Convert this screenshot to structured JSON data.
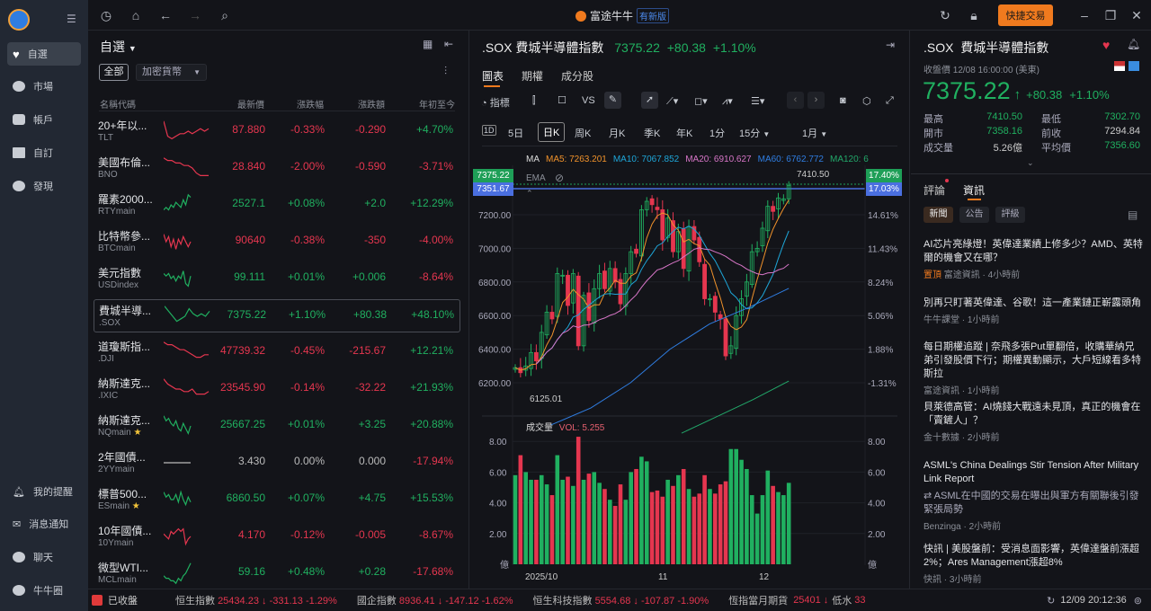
{
  "app": {
    "logo_text": "富途牛牛",
    "badge": "有新版",
    "quick_trade": "快捷交易"
  },
  "sidebar": {
    "items": [
      {
        "label": "自選"
      },
      {
        "label": "市場"
      },
      {
        "label": "帳戶"
      },
      {
        "label": "自訂"
      },
      {
        "label": "發現"
      }
    ],
    "bottom": [
      {
        "label": "我的提醒"
      },
      {
        "label": "消息通知"
      },
      {
        "label": "聊天"
      },
      {
        "label": "牛牛圈"
      }
    ]
  },
  "watchlist": {
    "title": "自選",
    "filter_all": "全部",
    "filter_select": "加密貨幣",
    "headers": [
      "名稱代碼",
      "最新價",
      "漲跌幅",
      "漲跌額",
      "年初至今"
    ],
    "rows": [
      {
        "name": "20+年以...",
        "code": "TLT",
        "price": "87.880",
        "pct": "-0.33%",
        "chg": "-0.290",
        "ytd": "+4.70%",
        "dir": "r",
        "ytd_dir": "g",
        "spark": [
          9,
          3,
          2,
          3,
          4,
          4,
          5,
          4,
          5,
          6,
          5,
          6
        ]
      },
      {
        "name": "美國布倫...",
        "code": "BNO",
        "price": "28.840",
        "pct": "-2.00%",
        "chg": "-0.590",
        "ytd": "-3.71%",
        "dir": "r",
        "ytd_dir": "r",
        "spark": [
          9,
          8,
          8,
          7,
          7,
          6,
          6,
          5,
          3,
          2,
          2,
          2
        ]
      },
      {
        "name": "羅素2000...",
        "code": "RTYmain",
        "price": "2527.1",
        "pct": "+0.08%",
        "chg": "+2.0",
        "ytd": "+12.29%",
        "dir": "g",
        "ytd_dir": "g",
        "spark": [
          3,
          4,
          3,
          5,
          4,
          6,
          5,
          4,
          7,
          5,
          9,
          8
        ]
      },
      {
        "name": "比特幣參...",
        "code": "BTCmain",
        "price": "90640",
        "pct": "-0.38%",
        "chg": "-350",
        "ytd": "-4.00%",
        "dir": "r",
        "ytd_dir": "r",
        "spark": [
          8,
          5,
          7,
          3,
          6,
          2,
          6,
          4,
          7,
          5,
          3,
          5
        ]
      },
      {
        "name": "美元指數",
        "code": "USDindex",
        "price": "99.111",
        "pct": "+0.01%",
        "chg": "+0.006",
        "ytd": "-8.64%",
        "dir": "g",
        "ytd_dir": "r",
        "spark": [
          7,
          6,
          7,
          5,
          6,
          4,
          6,
          5,
          8,
          3,
          2,
          6
        ]
      },
      {
        "name": "費城半導...",
        "code": ".SOX",
        "price": "7375.22",
        "pct": "+1.10%",
        "chg": "+80.38",
        "ytd": "+48.10%",
        "dir": "g",
        "ytd_dir": "g",
        "spark": [
          9,
          7,
          5,
          3,
          4,
          5,
          8,
          6,
          5,
          6,
          5,
          7
        ]
      },
      {
        "name": "道瓊斯指...",
        "code": ".DJI",
        "price": "47739.32",
        "pct": "-0.45%",
        "chg": "-215.67",
        "ytd": "+12.21%",
        "dir": "r",
        "ytd_dir": "g",
        "spark": [
          9,
          8,
          8,
          7,
          6,
          6,
          5,
          4,
          3,
          3,
          4,
          4
        ]
      },
      {
        "name": "納斯達克...",
        "code": ".IXIC",
        "price": "23545.90",
        "pct": "-0.14%",
        "chg": "-32.22",
        "ytd": "+21.93%",
        "dir": "r",
        "ytd_dir": "g",
        "spark": [
          9,
          7,
          6,
          5,
          5,
          4,
          4,
          5,
          3,
          3,
          3,
          4
        ]
      },
      {
        "name": "納斯達克...",
        "code": "NQmain",
        "price": "25667.25",
        "pct": "+0.01%",
        "chg": "+3.25",
        "ytd": "+20.88%",
        "dir": "g",
        "ytd_dir": "g",
        "spark": [
          9,
          7,
          8,
          6,
          5,
          7,
          4,
          3,
          6,
          4,
          2,
          5
        ]
      },
      {
        "name": "2年國債...",
        "code": "2YYmain",
        "price": "3.430",
        "pct": "0.00%",
        "chg": "0.000",
        "ytd": "-17.94%",
        "dir": "n",
        "ytd_dir": "r",
        "spark": [
          5,
          5,
          5,
          5,
          5,
          5,
          5,
          5,
          5,
          5,
          5,
          5
        ]
      },
      {
        "name": "標普500...",
        "code": "ESmain",
        "price": "6860.50",
        "pct": "+0.07%",
        "chg": "+4.75",
        "ytd": "+15.53%",
        "dir": "g",
        "ytd_dir": "g",
        "spark": [
          8,
          6,
          7,
          5,
          5,
          7,
          4,
          8,
          5,
          3,
          6,
          4
        ]
      },
      {
        "name": "10年國債...",
        "code": "10Ymain",
        "price": "4.170",
        "pct": "-0.12%",
        "chg": "-0.005",
        "ytd": "-8.67%",
        "dir": "r",
        "ytd_dir": "r",
        "spark": [
          6,
          5,
          4,
          7,
          6,
          7,
          8,
          7,
          8,
          2,
          4,
          5
        ]
      },
      {
        "name": "微型WTI...",
        "code": "MCLmain",
        "price": "59.16",
        "pct": "+0.48%",
        "chg": "+0.28",
        "ytd": "-17.68%",
        "dir": "g",
        "ytd_dir": "r",
        "spark": [
          4,
          3,
          3,
          2,
          2,
          1,
          3,
          2,
          4,
          5,
          7,
          9
        ]
      }
    ]
  },
  "chart": {
    "code": ".SOX",
    "name": "費城半導體指數",
    "price": "7375.22",
    "chg": "+80.38",
    "pct": "+1.10%",
    "tabs": [
      "圖表",
      "期權",
      "成分股"
    ],
    "toolbar_indicator": "指標",
    "toolbar_vs": "VS",
    "periods": [
      "5日",
      "日K",
      "周K",
      "月K",
      "季K",
      "年K",
      "1分",
      "15分",
      "1月"
    ],
    "ma_label": "MA",
    "ma": [
      {
        "label": "MA5: 7263.201",
        "color": "#f0922b"
      },
      {
        "label": "MA10: 7067.852",
        "color": "#1ea6d8"
      },
      {
        "label": "MA20: 6910.627",
        "color": "#d876c8"
      },
      {
        "label": "MA60: 6762.772",
        "color": "#2f7de1"
      },
      {
        "label": "MA120: 6",
        "color": "#22a86a"
      }
    ],
    "ema_label": "EMA",
    "price_tag": "7375.22",
    "line_tag": "7351.67",
    "pct_tag": "17.40%",
    "line_pct_tag": "17.03%",
    "high_mark": "7410.50",
    "low_mark": "6125.01",
    "y_labels": [
      "7200.00",
      "7000.00",
      "6800.00",
      "6600.00",
      "6400.00",
      "6200.00"
    ],
    "pct_labels": [
      "14.61%",
      "11.43%",
      "8.24%",
      "5.06%",
      "1.88%",
      "-1.31%"
    ],
    "vol_label": "成交量",
    "vol_value": "VOL: 5.255",
    "vol_y_labels": [
      "8.00",
      "6.00",
      "4.00",
      "2.00",
      "億"
    ],
    "x_labels": [
      "2025/10",
      "11",
      "12"
    ]
  },
  "chart_data": {
    "type": "candlestick",
    "ylim": [
      6000,
      7450
    ],
    "closes": [
      6290,
      6260,
      6300,
      6380,
      6330,
      6500,
      6620,
      6580,
      6850,
      6840,
      6660,
      6850,
      6420,
      6720,
      6570,
      6760,
      6850,
      6760,
      6880,
      6800,
      6670,
      6850,
      6980,
      6970,
      7230,
      7280,
      7260,
      7230,
      7050,
      7180,
      6980,
      7100,
      6880,
      7130,
      7050,
      6920,
      6700,
      6700,
      6620,
      6580,
      6360,
      6420,
      6600,
      6700,
      6800,
      6980,
      7000,
      7120,
      7250,
      7220,
      7300,
      7294.84,
      7375.22
    ],
    "volumes": [
      5.8,
      7.1,
      6.0,
      5.5,
      5.5,
      5.8,
      5.2,
      4.5,
      7.1,
      5.5,
      5.7,
      5.1,
      8.3,
      5.5,
      5.9,
      6.0,
      5.3,
      4.9,
      4.2,
      3.8,
      5.2,
      4.2,
      6.0,
      6.2,
      7.0,
      6.7,
      4.7,
      4.8,
      4.4,
      5.5,
      5.1,
      5.8,
      6.2,
      4.9,
      4.4,
      4.6,
      5.8,
      4.9,
      4.6,
      5.2,
      5.4,
      7.5,
      7.5,
      6.8,
      6.2,
      4.5,
      3.3,
      4.5,
      6.1,
      5.1,
      4.7,
      4.5,
      5.3
    ],
    "ma60": [
      5950,
      6050,
      6200,
      6400,
      6550,
      6650,
      6762
    ],
    "ma120": [
      5900,
      6000,
      6100,
      6210
    ]
  },
  "quote": {
    "code": ".SOX",
    "name": "費城半導體指數",
    "close_time": "收盤價 12/08 16:00:00 (美東)",
    "price": "7375.22",
    "chg": "+80.38",
    "pct": "+1.10%",
    "stats": [
      {
        "k": "最高",
        "v": "7410.50",
        "c": "g"
      },
      {
        "k": "最低",
        "v": "7302.70",
        "c": "g"
      },
      {
        "k": "開市",
        "v": "7358.16",
        "c": "g"
      },
      {
        "k": "前收",
        "v": "7294.84",
        "c": "n"
      },
      {
        "k": "成交量",
        "v": "5.26億",
        "c": "n"
      },
      {
        "k": "平均價",
        "v": "7356.60",
        "c": "g"
      }
    ],
    "tabs": [
      "評論",
      "資訊"
    ],
    "subtabs": [
      "新聞",
      "公告",
      "評級"
    ]
  },
  "news": [
    {
      "title": "AI芯片亮綠燈！英偉達業績上修多少？AMD、英特爾的機會又在哪？",
      "tag": "置頂",
      "meta": "富途資訊 · 4小時前"
    },
    {
      "title": "別再只盯著英偉達、谷歌！這一產業鏈正嶄露頭角",
      "meta": "牛牛課堂 · 1小時前"
    },
    {
      "title": "每日期權追蹤 | 奈飛多張Put單翻倍，收購華納兄弟引發股價下行；期權異動顯示，大戶短線看多特斯拉",
      "meta": "富途資訊 · 1小時前"
    },
    {
      "title": "貝萊德高管：AI燒錢大戰遠未見頂，真正的機會在「賣鏟人」？",
      "meta": "金十數據 · 2小時前"
    },
    {
      "title": "ASML's China Dealings Stir Tension After Military Link Report",
      "sub": "ASML在中國的交易在曝出與軍方有關聯後引發緊張局勢",
      "meta": "Benzinga · 2小時前"
    },
    {
      "title": "快訊 | 美股盤前：受消息面影響，英偉達盤前漲超2%；Ares Management漲超8%",
      "meta": "快訊 · 3小時前"
    }
  ],
  "bottom": {
    "status": "已收盤",
    "tickers": [
      {
        "name": "恒生指數",
        "val": "25434.23",
        "chg": "-331.13",
        "pct": "-1.29%"
      },
      {
        "name": "國企指數",
        "val": "8936.41",
        "chg": "-147.12",
        "pct": "-1.62%"
      },
      {
        "name": "恒生科技指數",
        "val": "5554.68",
        "chg": "-107.87",
        "pct": "-1.90%"
      }
    ],
    "fut_name": "恆指當月期貨",
    "fut_val": "25401",
    "fut_label": "低水",
    "fut_diff": "33",
    "time": "12/09 20:12:36"
  }
}
